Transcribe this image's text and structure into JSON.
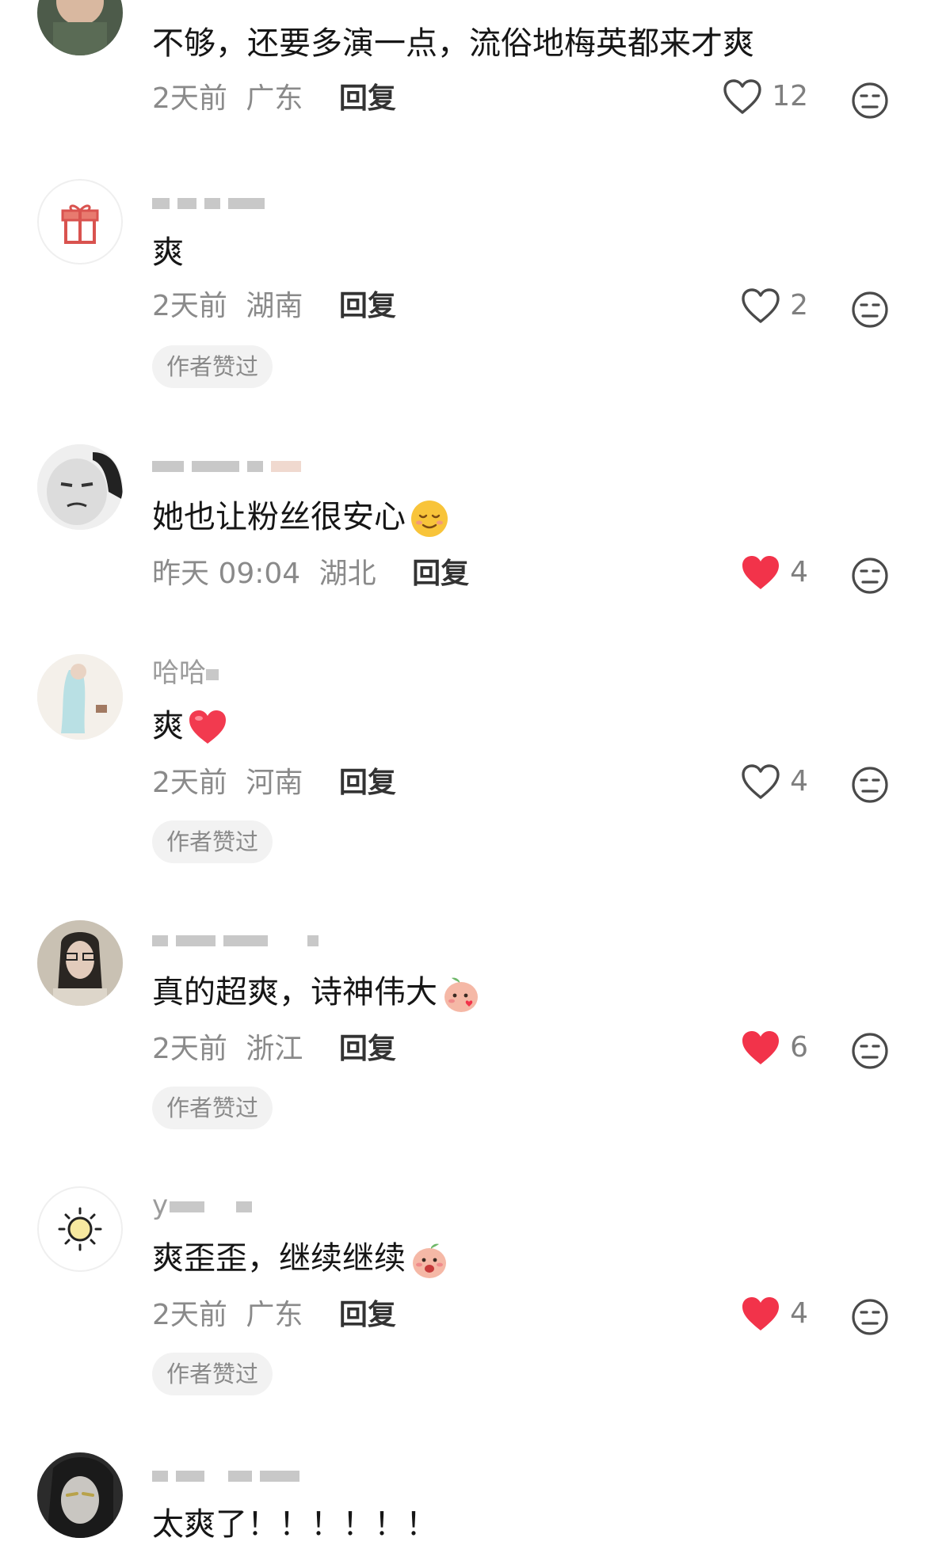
{
  "comments": [
    {
      "text": "不够，还要多演一点，流俗地梅英都来才爽",
      "date": "2天前",
      "region": "广东",
      "reply": "回复",
      "likes": "12",
      "liked": false
    },
    {
      "text": "爽",
      "date": "2天前",
      "region": "湖南",
      "reply": "回复",
      "likes": "2",
      "liked": false,
      "badge": "作者赞过"
    },
    {
      "text": "她也让粉丝很安心",
      "date": "昨天 09:04",
      "region": "湖北",
      "reply": "回复",
      "likes": "4",
      "liked": true
    },
    {
      "username": "哈哈",
      "text": "爽",
      "date": "2天前",
      "region": "河南",
      "reply": "回复",
      "likes": "4",
      "liked": false,
      "badge": "作者赞过"
    },
    {
      "text": "真的超爽，诗神伟大",
      "date": "2天前",
      "region": "浙江",
      "reply": "回复",
      "likes": "6",
      "liked": true,
      "badge": "作者赞过"
    },
    {
      "username": "y",
      "text": "爽歪歪，继续继续",
      "date": "2天前",
      "region": "广东",
      "reply": "回复",
      "likes": "4",
      "liked": true,
      "badge": "作者赞过"
    },
    {
      "text": "太爽了！！！！！！"
    }
  ],
  "colors": {
    "liked": "#f2334a",
    "muted": "#8a8a8a",
    "text": "#161616"
  },
  "icons": [
    "heart-outline-icon",
    "heart-filled-icon",
    "dislike-face-icon",
    "gift-icon",
    "sun-icon"
  ]
}
